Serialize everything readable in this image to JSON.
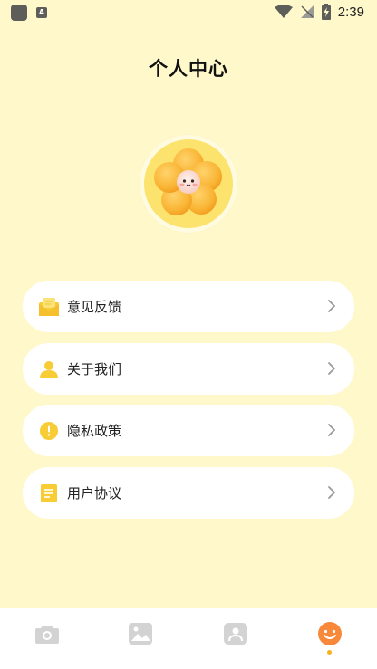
{
  "status_bar": {
    "time": "2:39",
    "a_label": "A"
  },
  "header": {
    "title": "个人中心"
  },
  "menu": {
    "items": [
      {
        "label": "意见反馈",
        "icon": "feedback-envelope-icon"
      },
      {
        "label": "关于我们",
        "icon": "person-icon"
      },
      {
        "label": "隐私政策",
        "icon": "exclamation-circle-icon"
      },
      {
        "label": "用户协议",
        "icon": "document-icon"
      }
    ]
  },
  "bottom_nav": {
    "items": [
      {
        "icon": "camera-icon",
        "active": false
      },
      {
        "icon": "gallery-icon",
        "active": false
      },
      {
        "icon": "person-card-icon",
        "active": false
      },
      {
        "icon": "smiley-icon",
        "active": true
      }
    ]
  },
  "colors": {
    "background": "#FEF8CB",
    "accent_yellow": "#F7CC34",
    "active_orange": "#F9893A",
    "inactive_gray": "#D3D3D3"
  }
}
